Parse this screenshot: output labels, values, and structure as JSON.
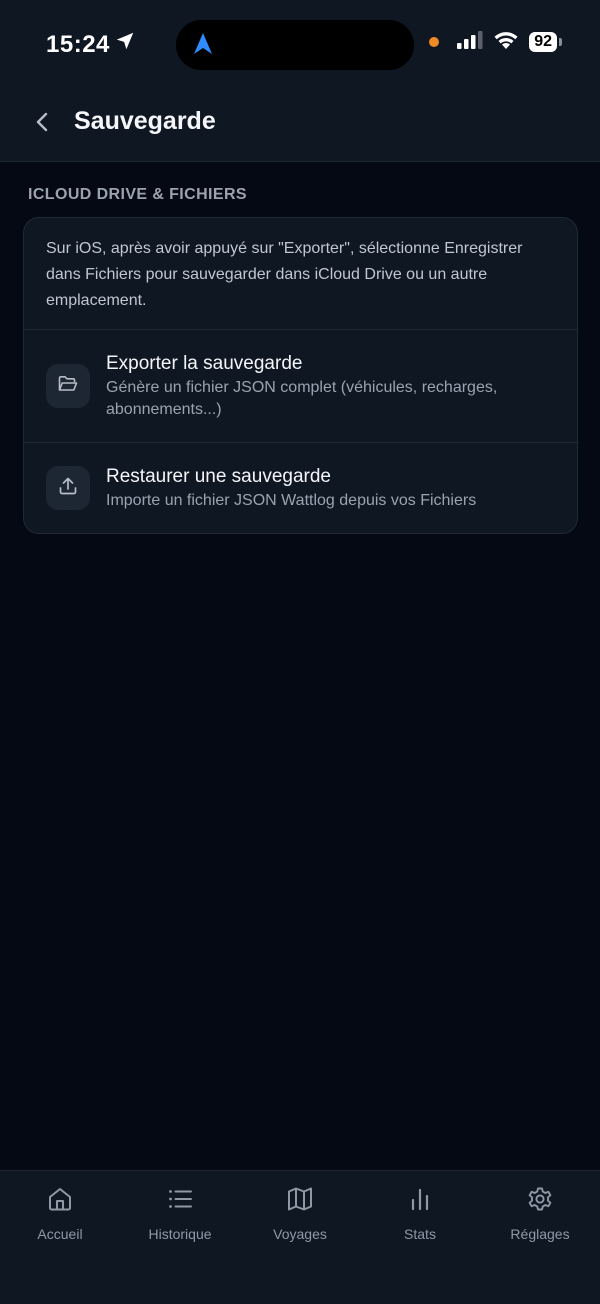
{
  "status_bar": {
    "time": "15:24",
    "battery": "92",
    "icons": [
      "location-arrow-icon",
      "navigation-icon",
      "signal-icon",
      "wifi-icon",
      "battery-icon"
    ]
  },
  "header": {
    "title": "Sauvegarde",
    "back_icon": "chevron-left-icon"
  },
  "section": {
    "label": "ICLOUD DRIVE & FICHIERS",
    "description": "Sur iOS, après avoir appuyé sur \"Exporter\", sélectionne Enregistrer dans Fichiers pour sauvegarder dans iCloud Drive ou un autre emplacement.",
    "rows": [
      {
        "icon": "folder-open-icon",
        "title": "Exporter la sauvegarde",
        "subtitle": "Génère un fichier JSON complet (véhicules, recharges, abonnements...)"
      },
      {
        "icon": "upload-icon",
        "title": "Restaurer une sauvegarde",
        "subtitle": "Importe un fichier JSON Wattlog depuis vos Fichiers"
      }
    ]
  },
  "tab_bar": {
    "tabs": [
      {
        "label": "Accueil",
        "icon": "home-icon"
      },
      {
        "label": "Historique",
        "icon": "list-icon"
      },
      {
        "label": "Voyages",
        "icon": "map-icon"
      },
      {
        "label": "Stats",
        "icon": "bar-chart-icon"
      },
      {
        "label": "Réglages",
        "icon": "gear-icon",
        "active": true
      }
    ]
  },
  "colors": {
    "background": "#040913",
    "surface": "#0f1723",
    "accent_blue": "#2f8cff",
    "dot_orange": "#f08a24"
  }
}
